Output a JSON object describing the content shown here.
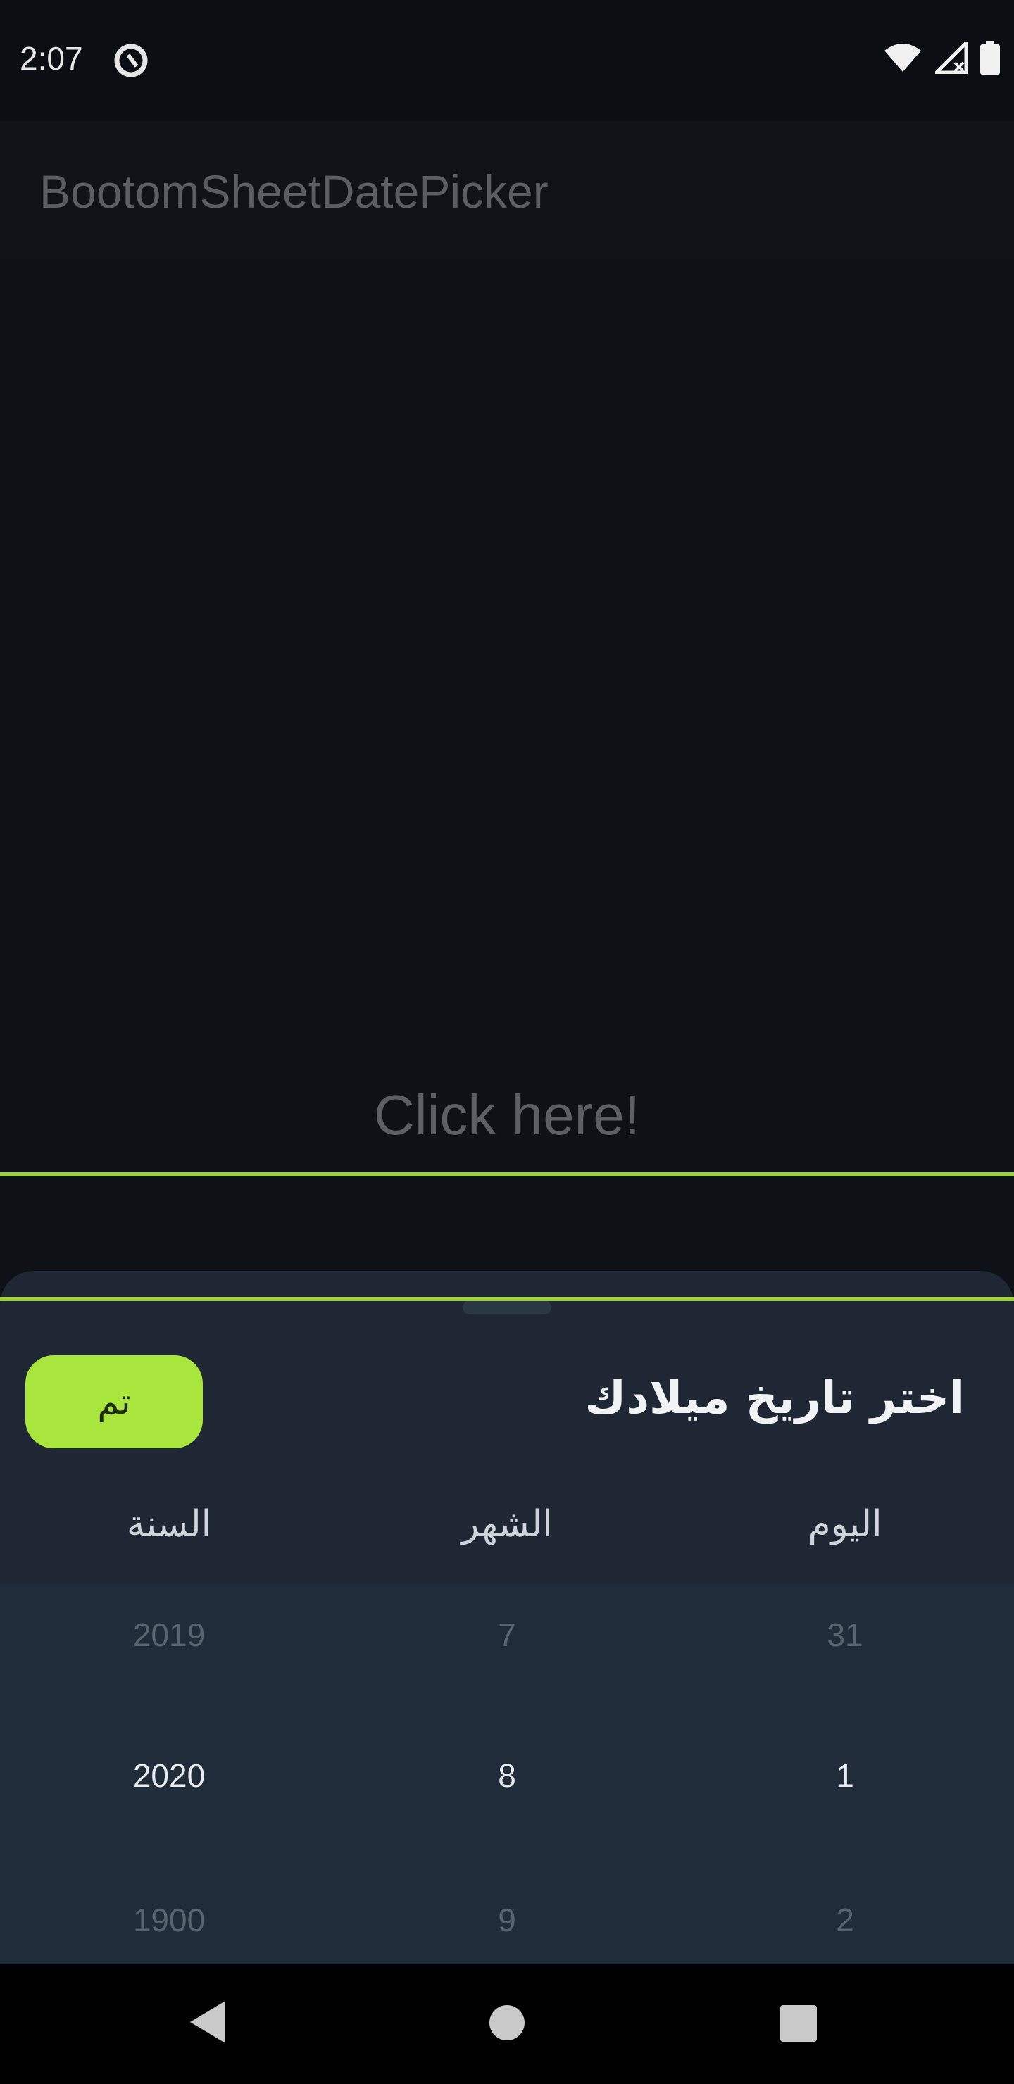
{
  "status_bar": {
    "time": "2:07",
    "icons": [
      "vpn-ring-icon",
      "wifi-icon",
      "signal-icon",
      "battery-icon"
    ]
  },
  "app_bar": {
    "title": "BootomSheetDatePicker"
  },
  "main": {
    "click_text": "Click here!"
  },
  "bottom_sheet": {
    "title": "اختر تاريخ ميلادك",
    "done_label": "تم",
    "done_color": "#a8e53d",
    "columns": {
      "year": "السنة",
      "month": "الشهر",
      "day": "اليوم"
    },
    "rows": {
      "previous": {
        "year": "2019",
        "month": "7",
        "day": "31"
      },
      "selected": {
        "year": "2020",
        "month": "8",
        "day": "1"
      },
      "next": {
        "year": "1900",
        "month": "9",
        "day": "2"
      }
    },
    "selection_line_color": "#9ccf3f"
  },
  "nav_bar": {
    "icons": [
      "back-icon",
      "home-icon",
      "recents-icon"
    ]
  }
}
